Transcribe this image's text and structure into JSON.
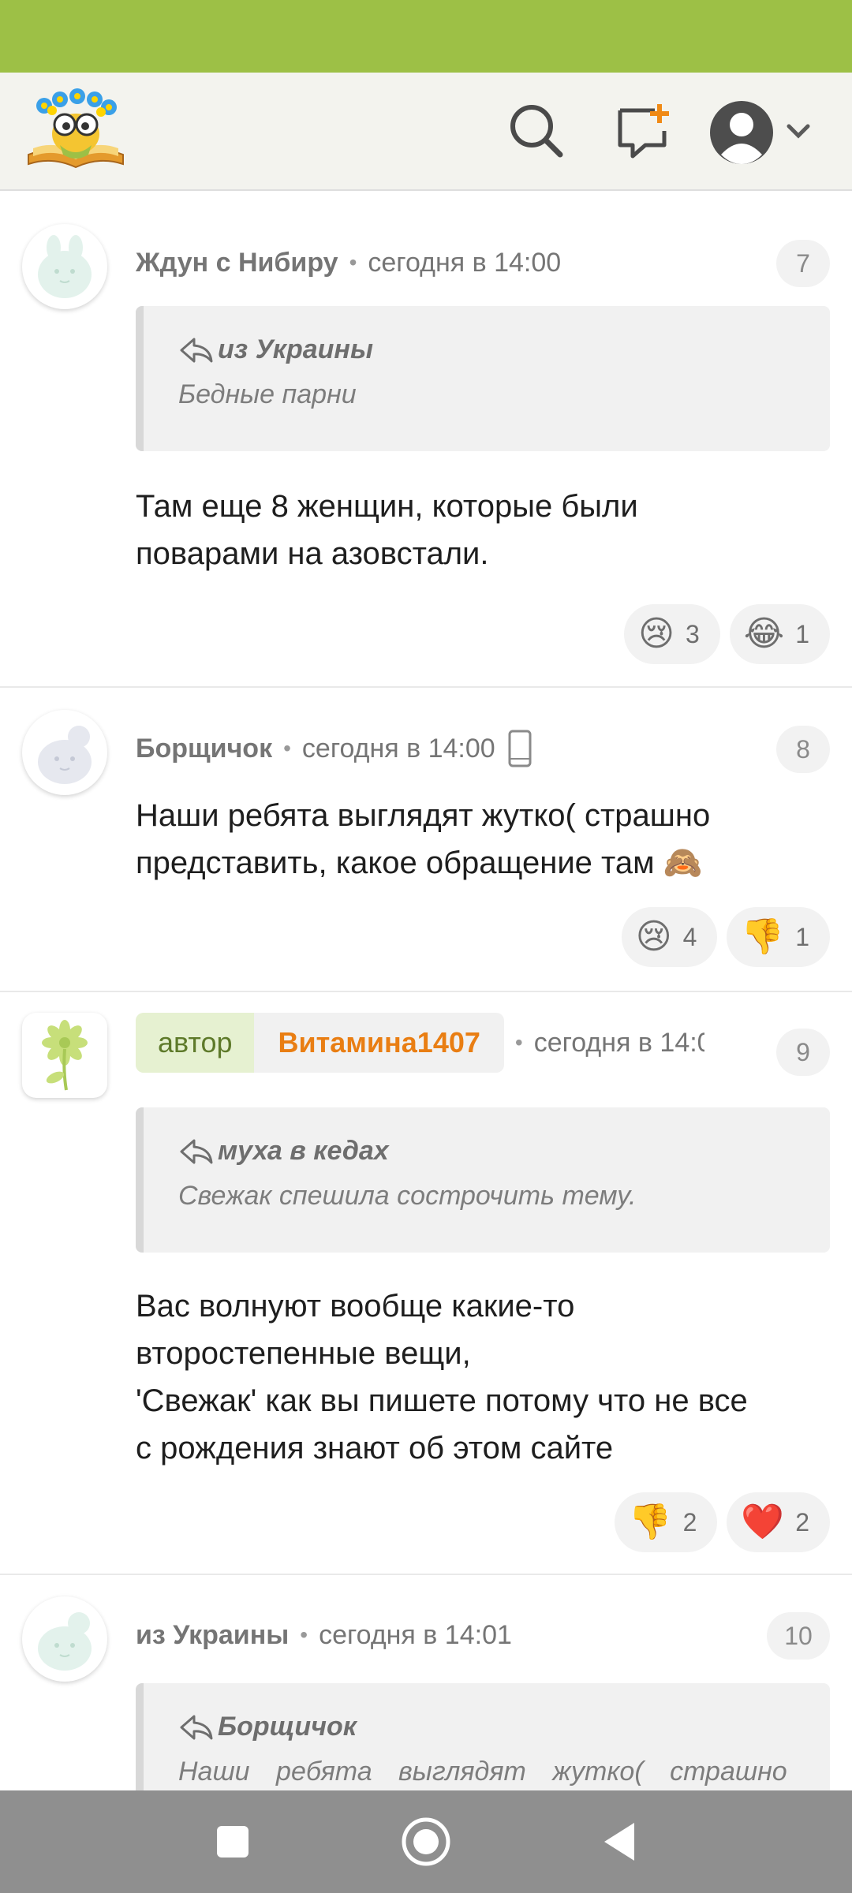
{
  "comments": [
    {
      "author": "Ждун с Нибиру",
      "time": "сегодня в 14:00",
      "number": "7",
      "quote": {
        "author": "из Украины",
        "text": "Бедные парни"
      },
      "lines": [
        "Там еще 8 женщин, которые были",
        "поварами на азовстали."
      ],
      "reactions": [
        {
          "emoji": "😢",
          "count": "3"
        },
        {
          "emoji": "😂",
          "count": "1"
        }
      ]
    },
    {
      "author": "Борщичок",
      "time": "сегодня в 14:00",
      "number": "8",
      "device_icon": "mobile-phone-icon",
      "lines": [
        "Наши ребята выглядят жутко( страшно",
        "представить, какое обращение там 🙈"
      ],
      "reactions": [
        {
          "emoji": "😢",
          "count": "4"
        },
        {
          "emoji": "👎",
          "count": "1"
        }
      ]
    },
    {
      "author_tag": "автор",
      "author": "Витамина1407",
      "time": "сегодня в 14:0",
      "number": "9",
      "quote": {
        "author": "муха в кедах",
        "text": "Свежак спешила сострочить тему."
      },
      "lines": [
        "Вас волнуют вообще какие-то",
        "второстепенные вещи,",
        "'Свежак' как вы пишете потому что не все",
        "с рождения знают об этом сайте"
      ],
      "reactions": [
        {
          "emoji": "👎",
          "count": "2"
        },
        {
          "emoji": "❤️",
          "count": "2"
        }
      ]
    },
    {
      "author": "из Украины",
      "time": "сегодня в 14:01",
      "number": "10",
      "quote": {
        "author": "Борщичок",
        "text": "Наши ребята выглядят жутко( страшно"
      }
    }
  ],
  "icons": {
    "logo": "site-logo",
    "search": "search-icon",
    "new_post": "new-post-icon",
    "profile": "avatar-icon",
    "reply": "reply-arrow-icon"
  },
  "colors": {
    "status_bar": "#9dc046",
    "author_name": "#e97e13",
    "author_tag_bg": "#e6f1d1"
  }
}
